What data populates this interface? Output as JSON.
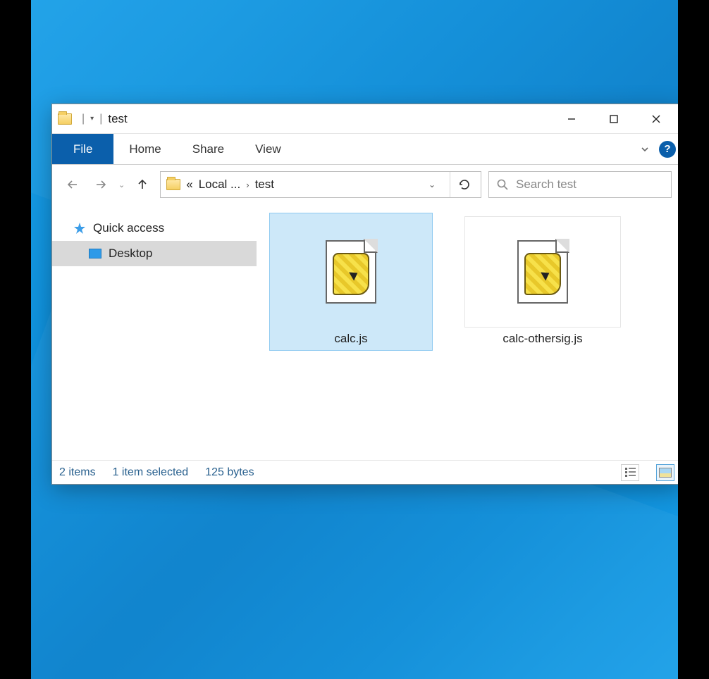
{
  "window": {
    "title": "test"
  },
  "ribbon": {
    "tabs": {
      "file": "File",
      "home": "Home",
      "share": "Share",
      "view": "View"
    }
  },
  "address": {
    "overflow": "«",
    "crumbs": {
      "parent": "Local ...",
      "current": "test"
    }
  },
  "search": {
    "placeholder": "Search test"
  },
  "nav": {
    "quick_access": "Quick access",
    "desktop": "Desktop"
  },
  "files": [
    {
      "name": "calc.js",
      "selected": true
    },
    {
      "name": "calc-othersig.js",
      "selected": false
    }
  ],
  "status": {
    "count": "2 items",
    "selection": "1 item selected",
    "size": "125 bytes"
  }
}
